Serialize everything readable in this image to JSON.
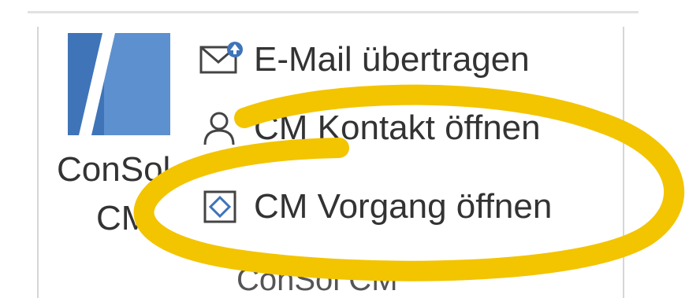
{
  "ribbon_group": {
    "big_button": {
      "label_line1": "ConSol",
      "label_line2": "CM"
    },
    "commands": [
      {
        "label": "E-Mail übertragen",
        "icon": "envelope-upload-icon"
      },
      {
        "label": "CM Kontakt öffnen",
        "icon": "person-icon"
      },
      {
        "label": "CM Vorgang öffnen",
        "icon": "diamond-square-icon"
      }
    ],
    "group_label": "ConSol CM"
  },
  "colors": {
    "logo_blue": "#3f74b8",
    "logo_blue_light": "#5d90cf",
    "highlight_yellow": "#f3c400",
    "text": "#333333"
  }
}
